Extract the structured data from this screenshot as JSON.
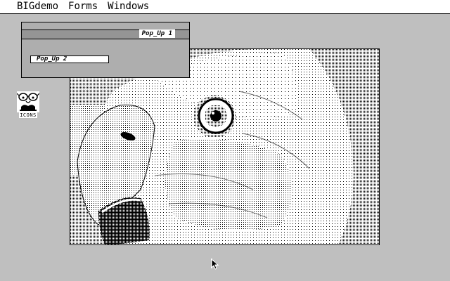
{
  "menubar": {
    "items": [
      "BIGdemo",
      "Forms",
      "Windows"
    ]
  },
  "desktop_icon": {
    "label": "ICONS",
    "icon": "glasses-icon"
  },
  "popup1": {
    "title": "Pop_Up 1"
  },
  "popup2": {
    "title": "Pop_Up 2"
  },
  "image_window": {
    "content": "parrot-image"
  },
  "colors": {
    "foreground": "#000000",
    "background": "#ffffff"
  },
  "cursor": {
    "icon": "arrow-pointer-icon"
  }
}
